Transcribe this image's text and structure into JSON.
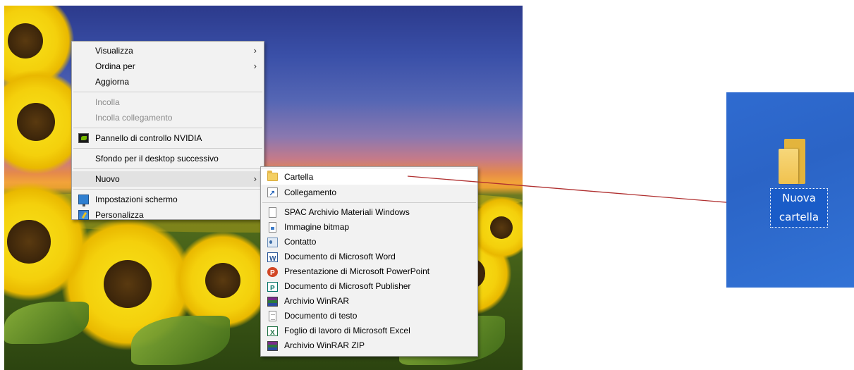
{
  "context_menu": {
    "items": [
      {
        "label": "Visualizza",
        "submenu": true
      },
      {
        "label": "Ordina per",
        "submenu": true
      },
      {
        "label": "Aggiorna"
      },
      {
        "label": "Incolla",
        "disabled": true
      },
      {
        "label": "Incolla collegamento",
        "disabled": true
      },
      {
        "label": "Pannello di controllo NVIDIA",
        "icon": "nvidia-icon"
      },
      {
        "label": "Sfondo per il desktop successivo"
      },
      {
        "label": "Nuovo",
        "submenu": true,
        "highlighted": true
      },
      {
        "label": "Impostazioni schermo",
        "icon": "display-settings-icon"
      },
      {
        "label": "Personalizza",
        "icon": "personalize-icon"
      }
    ],
    "chevron": "›"
  },
  "new_submenu": {
    "items": [
      {
        "label": "Cartella",
        "icon": "folder-icon"
      },
      {
        "label": "Collegamento",
        "icon": "shortcut-icon"
      },
      {
        "label": "SPAC Archivio Materiali Windows",
        "icon": "blank-document-icon"
      },
      {
        "label": "Immagine bitmap",
        "icon": "bitmap-icon"
      },
      {
        "label": "Contatto",
        "icon": "contact-icon"
      },
      {
        "label": "Documento di Microsoft Word",
        "icon": "word-icon"
      },
      {
        "label": "Presentazione di Microsoft PowerPoint",
        "icon": "powerpoint-icon"
      },
      {
        "label": "Documento di Microsoft Publisher",
        "icon": "publisher-icon"
      },
      {
        "label": "Archivio WinRAR",
        "icon": "winrar-icon"
      },
      {
        "label": "Documento di testo",
        "icon": "text-document-icon"
      },
      {
        "label": "Foglio di lavoro di Microsoft Excel",
        "icon": "excel-icon"
      },
      {
        "label": "Archivio WinRAR ZIP",
        "icon": "winrar-zip-icon"
      }
    ]
  },
  "result_folder": {
    "label_line1": "Nuova",
    "label_line2": "cartella"
  },
  "colors": {
    "arrow": "#b03030",
    "selection": "#1a5cc8",
    "desktop_blue": "#2f6bd0"
  }
}
